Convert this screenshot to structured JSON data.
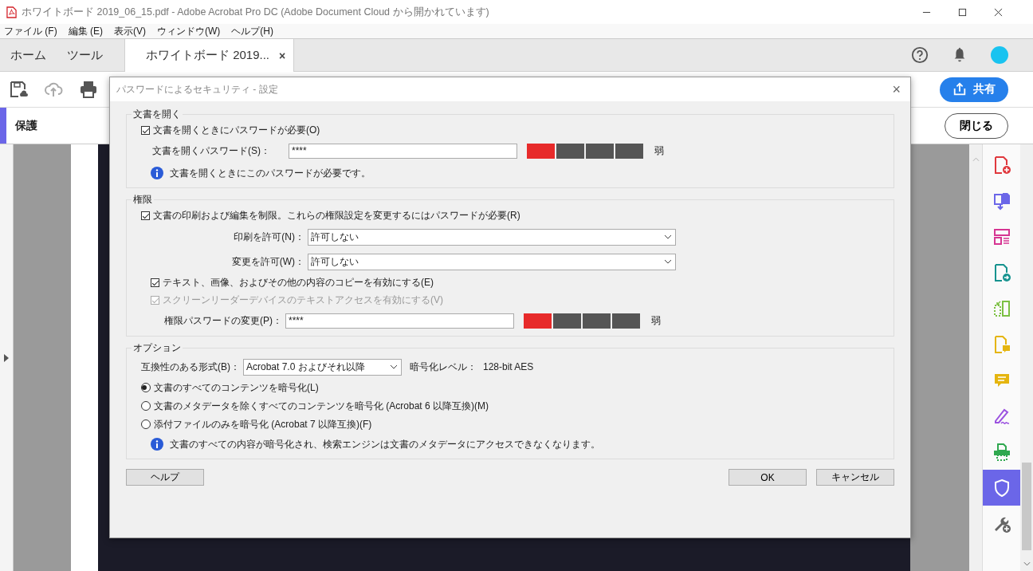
{
  "window": {
    "title": "ホワイトボード 2019_06_15.pdf - Adobe Acrobat Pro DC (Adobe Document Cloud から開かれています)"
  },
  "menu": [
    "ファイル (F)",
    "編集 (E)",
    "表示(V)",
    "ウィンドウ(W)",
    "ヘルプ(H)"
  ],
  "tabs": [
    {
      "label": "ホーム",
      "selected": false
    },
    {
      "label": "ツール",
      "selected": false
    },
    {
      "label": "ホワイトボード 2019...",
      "selected": true,
      "close": "×"
    }
  ],
  "share_button": "共有",
  "protect_bar": {
    "title": "保護",
    "close_button": "閉じる"
  },
  "tools_panel": [
    {
      "kind": "create",
      "selected": false
    },
    {
      "kind": "combine",
      "selected": false
    },
    {
      "kind": "organize",
      "selected": false
    },
    {
      "kind": "export",
      "selected": false
    },
    {
      "kind": "compare",
      "selected": false
    },
    {
      "kind": "comment-file",
      "selected": false
    },
    {
      "kind": "comment",
      "selected": false
    },
    {
      "kind": "sign",
      "selected": false
    },
    {
      "kind": "scan",
      "selected": false
    },
    {
      "kind": "protect",
      "selected": true
    },
    {
      "kind": "more",
      "selected": false
    }
  ],
  "dialog": {
    "title": "パスワードによるセキュリティ - 設定",
    "close": "×",
    "open_section": {
      "title": "文書を開く",
      "require": {
        "label": "文書を開くときにパスワードが必要(O)",
        "checked": true
      },
      "password": {
        "label": "文書を開くパスワード(S)：",
        "value": "****",
        "level": 0.25,
        "reading": "弱"
      },
      "info": "文書を開くときにこのパスワードが必要です。"
    },
    "permissions": {
      "title": "権限",
      "restrict": {
        "label": "文書の印刷および編集を制限。これらの権限設定を変更するにはパスワードが必要(R)",
        "checked": true
      },
      "selects": [
        {
          "label": "印刷を許可(N)：",
          "value": "許可しない"
        },
        {
          "label": "変更を許可(W)：",
          "value": "許可しない"
        }
      ],
      "options": [
        {
          "label": "テキスト、画像、およびその他の内容のコピーを有効にする(E)",
          "checked": true,
          "disabled": false
        },
        {
          "label": "スクリーンリーダーデバイスのテキストアクセスを有効にする(V)",
          "checked": true,
          "disabled": true
        }
      ],
      "password": {
        "label": "権限パスワードの変更(P)：",
        "value": "****",
        "level": 0.25,
        "reading": "弱"
      }
    },
    "options_section": {
      "title": "オプション",
      "compat": {
        "label": "互換性のある形式(B)：",
        "value": "Acrobat 7.0 およびそれ以降"
      },
      "encryption_label": "暗号化レベル：",
      "encryption_value": "128-bit AES",
      "radios": [
        {
          "label": "文書のすべてのコンテンツを暗号化(L)",
          "selected": true
        },
        {
          "label": "文書のメタデータを除くすべてのコンテンツを暗号化 (Acrobat 6 以降互換)(M)",
          "selected": false
        },
        {
          "label": "添付ファイルのみを暗号化 (Acrobat 7 以降互換)(F)",
          "selected": false
        }
      ],
      "info": "文書のすべての内容が暗号化され、検索エンジンは文書のメタデータにアクセスできなくなります。"
    },
    "buttons": [
      {
        "label": "ヘルプ",
        "kind": "help"
      },
      {
        "label": "OK",
        "kind": "ok"
      },
      {
        "label": "キャンセル",
        "kind": "cancel"
      }
    ]
  }
}
